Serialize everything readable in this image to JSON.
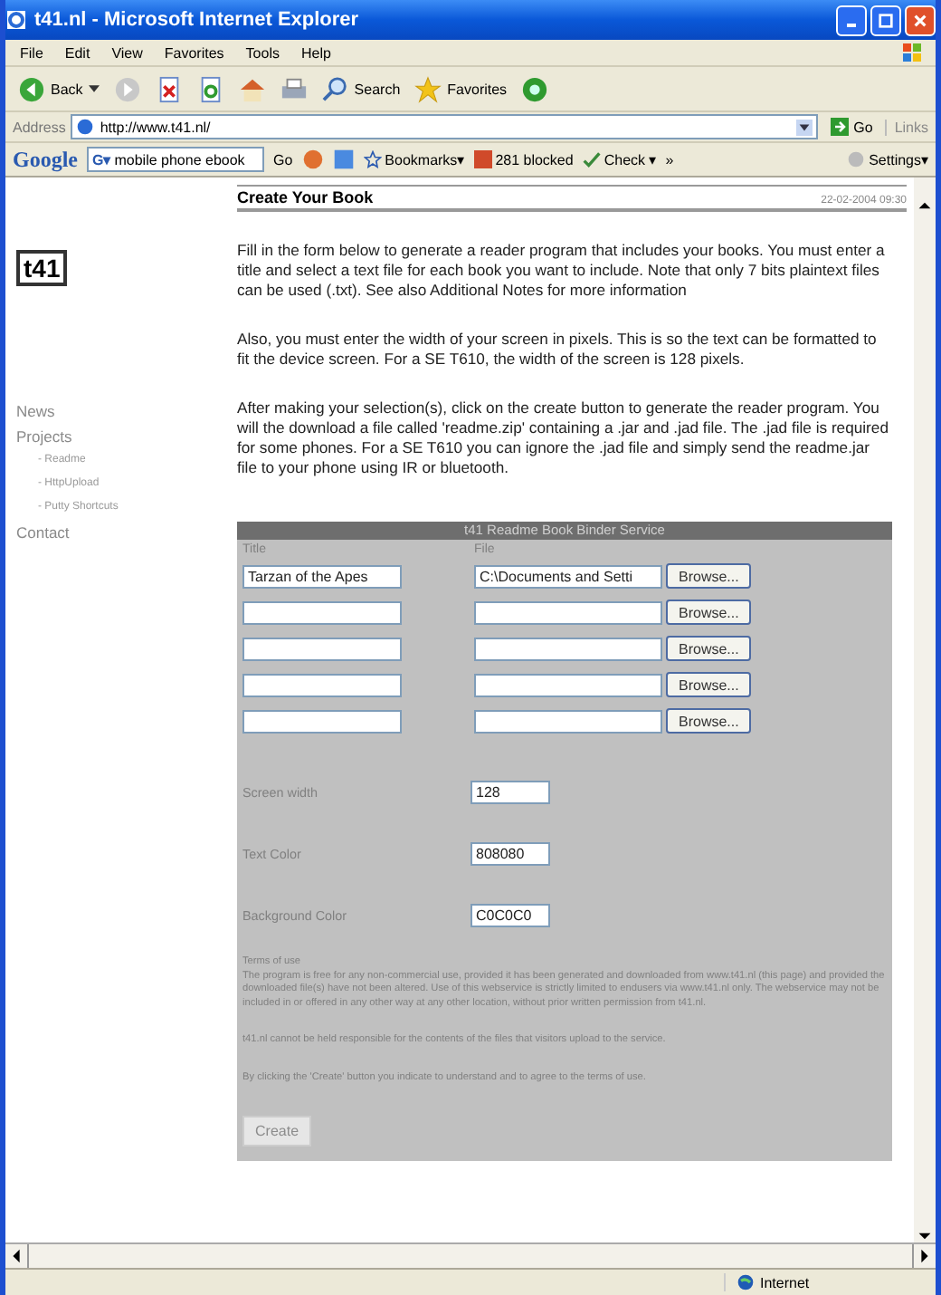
{
  "window": {
    "title": "t41.nl - Microsoft Internet Explorer"
  },
  "menu": [
    "File",
    "Edit",
    "View",
    "Favorites",
    "Tools",
    "Help"
  ],
  "toolbar": [
    {
      "kind": "back",
      "label": "Back"
    },
    {
      "kind": "forward"
    },
    {
      "kind": "stop"
    },
    {
      "kind": "refresh"
    },
    {
      "kind": "home"
    },
    {
      "kind": "print"
    },
    {
      "kind": "search",
      "label": "Search"
    },
    {
      "kind": "favorites",
      "label": "Favorites"
    },
    {
      "kind": "media"
    }
  ],
  "address": {
    "label": "Address",
    "url": "http://www.t41.nl/",
    "go": "Go",
    "links": "Links"
  },
  "google_bar": {
    "logo": "Google",
    "engine": "G▾",
    "query": "mobile phone ebook",
    "go": "Go",
    "bookmarks": "Bookmarks▾",
    "blocked": "281 blocked",
    "check": "Check ▾",
    "more": "»",
    "settings": "Settings▾"
  },
  "sidebar": {
    "logo": "t41",
    "items": [
      {
        "label": "News"
      },
      {
        "label": "Projects",
        "children": [
          {
            "label": "- Readme"
          },
          {
            "label": "- HttpUpload"
          },
          {
            "label": "- Putty Shortcuts"
          }
        ]
      },
      {
        "label": "Contact"
      }
    ]
  },
  "page": {
    "heading": "Create Your Book",
    "date": "22-02-2004 09:30",
    "paragraphs": [
      "Fill in the form below to generate a reader program that includes your books. You must enter a title and select a text file for each book you want to include. Note that only 7 bits plaintext files can be used (.txt). See also Additional Notes for more information",
      "Also, you must enter the width of your screen in pixels. This is so the text can be formatted to fit the device screen. For a SE T610, the width of the screen is 128 pixels.",
      "After making your selection(s), click on the create button to generate the reader program. You will the download a file called 'readme.zip' containing a .jar and .jad file. The .jad file is required for some phones. For a SE T610 you can ignore the .jad file and simply send the readme.jar file to your phone using IR or bluetooth."
    ],
    "form": {
      "title": "t41 Readme Book Binder Service",
      "columns": [
        "Title",
        "File"
      ],
      "books": [
        {
          "title": "Tarzan of the Apes",
          "file": "C:\\Documents and Setti",
          "browse": "Browse..."
        },
        {
          "browse": "Browse..."
        },
        {
          "browse": "Browse..."
        },
        {
          "browse": "Browse..."
        },
        {
          "browse": "Browse..."
        }
      ],
      "settings": [
        {
          "label": "Screen width",
          "value": "128"
        },
        {
          "label": "Text Color",
          "value": "808080"
        },
        {
          "label": "Background Color",
          "value": "C0C0C0"
        }
      ],
      "terms_heading": "Terms of use",
      "terms": [
        "The program is free for any non-commercial use, provided it has been generated and downloaded from www.t41.nl (this page) and provided the downloaded file(s) have not been altered. Use of this webservice is strictly limited to endusers via www.t41.nl only. The webservice may not be included in or offered in any other way at any other location, without prior written permission from t41.nl.",
        "t41.nl cannot be held responsible for the contents of the files that visitors upload to the service.",
        "By clicking the 'Create' button you indicate to understand and to agree to the terms of use."
      ],
      "create": {
        "label": "Create",
        "disabled": true
      }
    }
  },
  "status_bar": {
    "zone": "Internet"
  }
}
